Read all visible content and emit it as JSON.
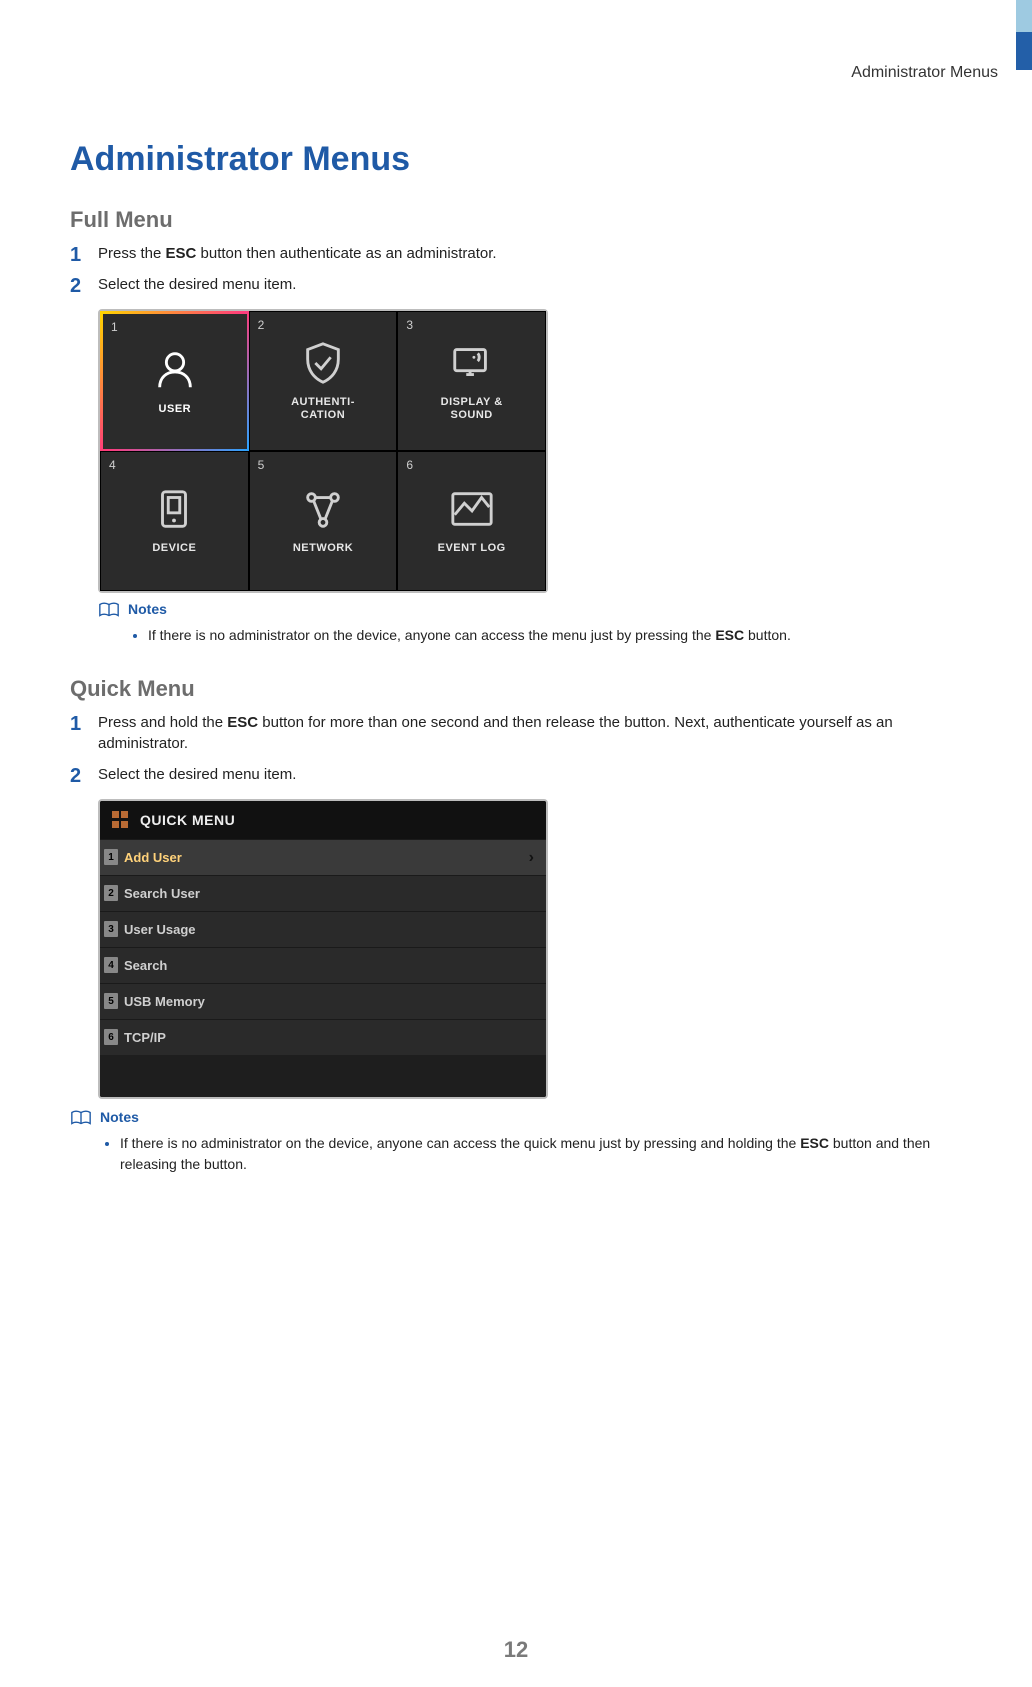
{
  "header": {
    "breadcrumb": "Administrator  Menus"
  },
  "title": "Administrator Menus",
  "full_menu": {
    "heading": "Full Menu",
    "steps": [
      {
        "pre": "Press the ",
        "bold": "ESC",
        "post": " button then authenticate as an administrator."
      },
      {
        "pre": "Select the desired menu item.",
        "bold": "",
        "post": ""
      }
    ],
    "tiles": [
      {
        "n": "1",
        "label": "USER",
        "selected": true
      },
      {
        "n": "2",
        "label": "AUTHENTI-\nCATION",
        "selected": false
      },
      {
        "n": "3",
        "label": "DISPLAY &\nSOUND",
        "selected": false
      },
      {
        "n": "4",
        "label": "DEVICE",
        "selected": false
      },
      {
        "n": "5",
        "label": "NETWORK",
        "selected": false
      },
      {
        "n": "6",
        "label": "EVENT LOG",
        "selected": false
      }
    ],
    "notes_label": "Notes",
    "notes": [
      {
        "pre": "If there is no administrator on the device, anyone can access the menu just by pressing the ",
        "bold": "ESC",
        "post": " button."
      }
    ]
  },
  "quick_menu": {
    "heading": "Quick Menu",
    "steps": [
      {
        "pre": "Press and hold the ",
        "bold": "ESC",
        "post": " button for more than one second and then release the button. Next, authenticate yourself as an administrator."
      },
      {
        "pre": "Select the desired menu item.",
        "bold": "",
        "post": ""
      }
    ],
    "title": "QUICK MENU",
    "items": [
      {
        "n": "1",
        "label": "Add User",
        "selected": true
      },
      {
        "n": "2",
        "label": "Search User",
        "selected": false
      },
      {
        "n": "3",
        "label": "User Usage",
        "selected": false
      },
      {
        "n": "4",
        "label": "Search",
        "selected": false
      },
      {
        "n": "5",
        "label": "USB Memory",
        "selected": false
      },
      {
        "n": "6",
        "label": "TCP/IP",
        "selected": false
      }
    ],
    "notes_label": "Notes",
    "notes": [
      {
        "pre": "If there is no administrator on the device, anyone can access the quick menu just by pressing and holding the ",
        "bold": "ESC",
        "post": " button and then releasing the button."
      }
    ]
  },
  "page_number": "12"
}
